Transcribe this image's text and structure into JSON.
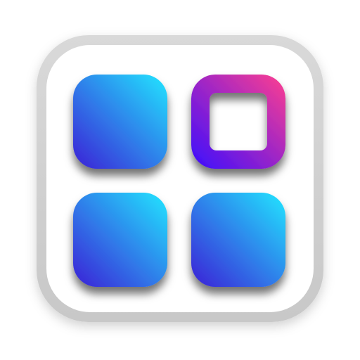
{
  "icon": {
    "name": "app-grid-icon",
    "frame": {
      "outer_color": "#d2d2d2",
      "inner_color": "#ffffff"
    },
    "tiles": [
      {
        "name": "tile-top-left",
        "style": "filled"
      },
      {
        "name": "tile-top-right",
        "style": "outline"
      },
      {
        "name": "tile-bottom-left",
        "style": "filled"
      },
      {
        "name": "tile-bottom-right",
        "style": "filled"
      }
    ],
    "colors": {
      "filled_start": "#22e6ff",
      "filled_end": "#3b1fd6",
      "outline_start": "#ff3f8f",
      "outline_end": "#3a0cff"
    }
  }
}
